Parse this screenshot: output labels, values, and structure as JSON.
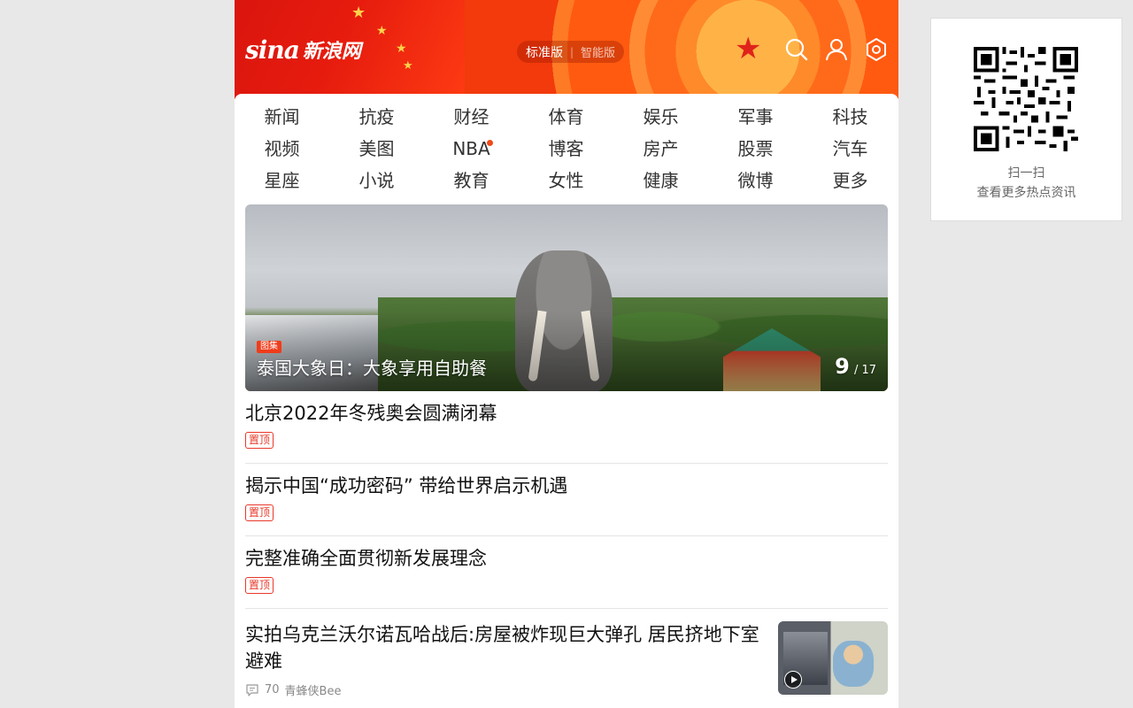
{
  "header": {
    "logo_en": "sina",
    "logo_cn": "新浪网",
    "version_standard": "标准版",
    "version_separator": "|",
    "version_smart": "智能版",
    "icons": [
      "search-icon",
      "user-icon",
      "settings-icon"
    ]
  },
  "nav": {
    "rows": [
      [
        "新闻",
        "抗疫",
        "财经",
        "体育",
        "娱乐",
        "军事",
        "科技"
      ],
      [
        "视频",
        "美图",
        "NBA",
        "博客",
        "房产",
        "股票",
        "汽车"
      ],
      [
        "星座",
        "小说",
        "教育",
        "女性",
        "健康",
        "微博",
        "更多"
      ]
    ]
  },
  "carousel": {
    "tag": "图集",
    "caption": "泰国大象日：大象享用自助餐",
    "current": "9",
    "total": "/ 17"
  },
  "news": [
    {
      "title": "北京2022年冬残奥会圆满闭幕",
      "badge": "置顶"
    },
    {
      "title": "揭示中国“成功密码” 带给世界启示机遇",
      "badge": "置顶"
    },
    {
      "title": "完整准确全面贯彻新发展理念",
      "badge": "置顶"
    },
    {
      "title": "实拍乌克兰沃尔诺瓦哈战后:房屋被炸现巨大弹孔 居民挤地下室避难",
      "comments": "70",
      "source": "青蜂侠Bee"
    }
  ],
  "qr_panel": {
    "line1": "扫一扫",
    "line2": "查看更多热点资讯"
  },
  "colors": {
    "brand_red": "#ee2a10",
    "badge_red": "#e8392a",
    "nav_dot": "#f04a1a"
  }
}
